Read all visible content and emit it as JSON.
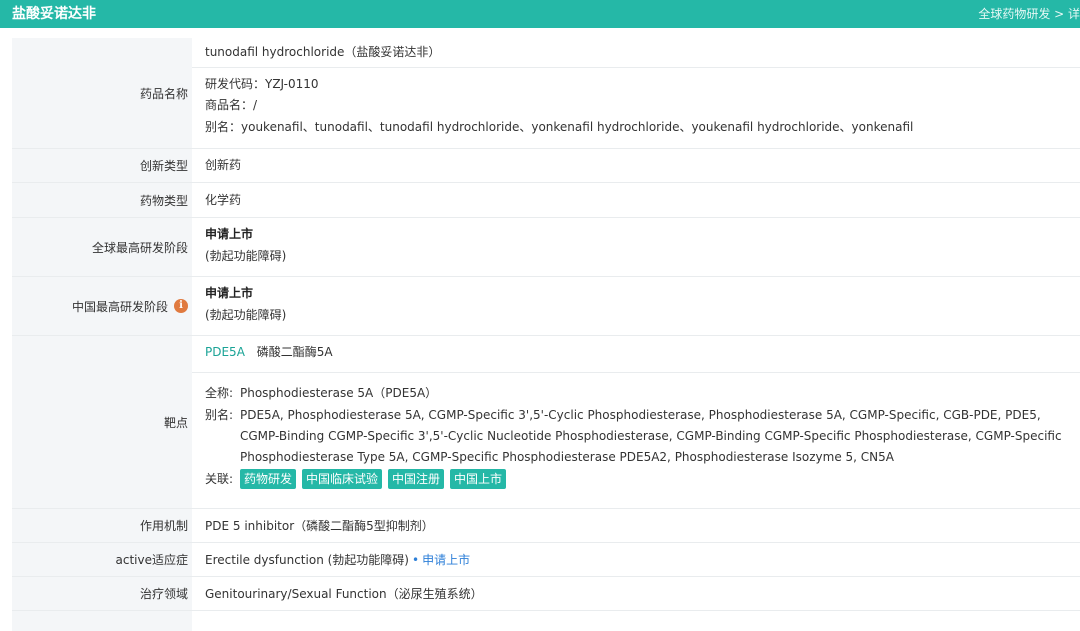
{
  "header": {
    "title": "盐酸妥诺达非",
    "breadcrumb": "全球药物研发 > 详"
  },
  "drug_name": {
    "label": "药品名称",
    "name": "tunodafil hydrochloride（盐酸妥诺达非）",
    "code": "研发代码：YZJ-0110",
    "brand": "商品名：/",
    "alias": "别名：youkenafil、tunodafil、tunodafil hydrochloride、yonkenafil hydrochloride、youkenafil hydrochloride、yonkenafil"
  },
  "innovation": {
    "label": "创新类型",
    "value": "创新药"
  },
  "drug_type": {
    "label": "药物类型",
    "value": "化学药"
  },
  "global_stage": {
    "label": "全球最高研发阶段",
    "stage": "申请上市",
    "indication": "(勃起功能障碍)"
  },
  "china_stage": {
    "label": "中国最高研发阶段",
    "info_icon": "i",
    "stage": "申请上市",
    "indication": "(勃起功能障碍)"
  },
  "target": {
    "label": "靶点",
    "code": "PDE5A",
    "cn_name": "磷酸二酯酶5A",
    "full_name_label": "全称:",
    "full_name": "Phosphodiesterase 5A（PDE5A）",
    "alias_label": "别名:",
    "alias": "PDE5A, Phosphodiesterase 5A, CGMP-Specific 3',5'-Cyclic Phosphodiesterase, Phosphodiesterase 5A, CGMP-Specific, CGB-PDE, PDE5, CGMP-Binding CGMP-Specific 3',5'-Cyclic Nucleotide Phosphodiesterase, CGMP-Binding CGMP-Specific Phosphodiesterase, CGMP-Specific Phosphodiesterase Type 5A, CGMP-Specific Phosphodiesterase PDE5A2, Phosphodiesterase Isozyme 5, CN5A",
    "related_label": "关联:",
    "tags": [
      "药物研发",
      "中国临床试验",
      "中国注册",
      "中国上市"
    ]
  },
  "mechanism": {
    "label": "作用机制",
    "value": "PDE 5 inhibitor（磷酸二酯酶5型抑制剂）"
  },
  "indication": {
    "label": "active适应症",
    "value": "Erectile dysfunction (勃起功能障碍)",
    "dot": "•",
    "status": "申请上市"
  },
  "therapeutic_area": {
    "label": "治疗领域",
    "value": "Genitourinary/Sexual Function（泌尿生殖系统）"
  },
  "colors": {
    "accent": "#25b8a7",
    "link_blue": "#2d7fd8",
    "info": "#e07a3f"
  }
}
